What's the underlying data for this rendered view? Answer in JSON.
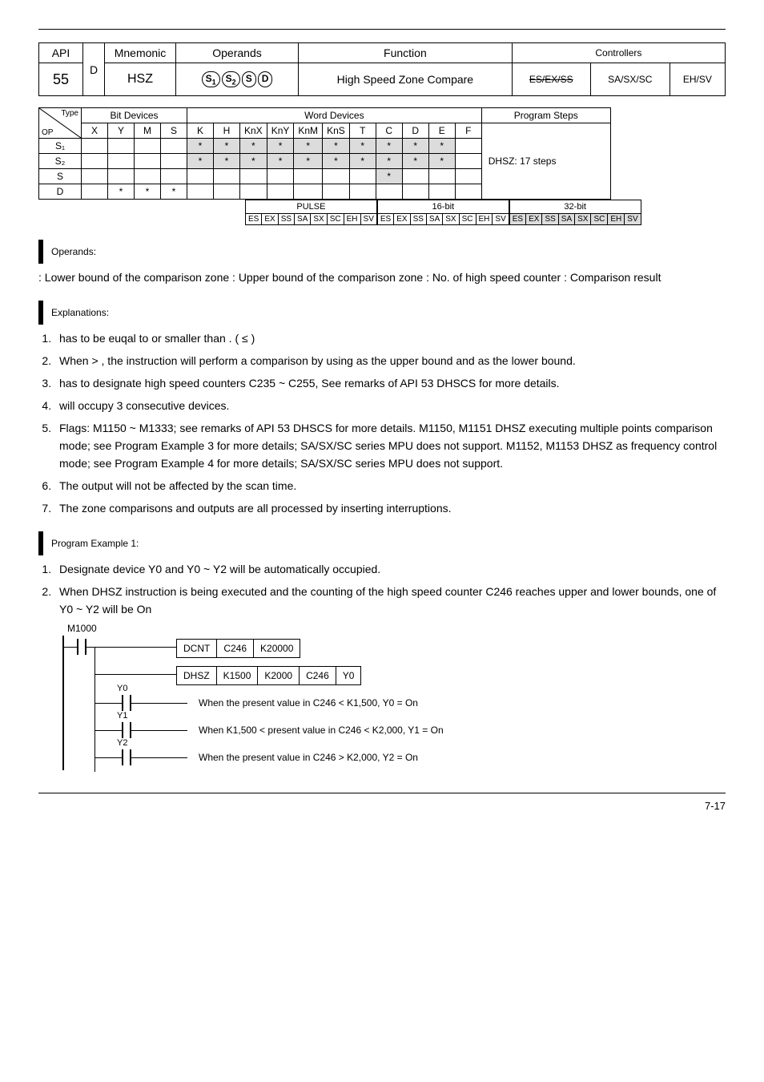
{
  "header": {
    "api_label": "API",
    "api_num": "55",
    "d_label": "D",
    "mnemonic_label": "Mnemonic",
    "mnemonic": "HSZ",
    "operands_label": "Operands",
    "pill_s1": "S",
    "pill_s2": "S",
    "pill_s": "S",
    "pill_d": "D",
    "sub1": "1",
    "sub2": "2",
    "function_label": "Function",
    "function_text": "High Speed Zone Compare",
    "ctrl_label": "Controllers",
    "ctrl_es": "ES/EX/SS",
    "ctrl_sa": "SA/SX/SC",
    "ctrl_eh": "EH/SV"
  },
  "grid": {
    "type_label": "Type",
    "op_label": "OP",
    "bit_label": "Bit Devices",
    "word_label": "Word Devices",
    "steps_label": "Program Steps",
    "cols": [
      "X",
      "Y",
      "M",
      "S",
      "K",
      "H",
      "KnX",
      "KnY",
      "KnM",
      "KnS",
      "T",
      "C",
      "D",
      "E",
      "F"
    ],
    "rows": {
      "s1": "S₁",
      "s2": "S₂",
      "s": "S",
      "d": "D"
    },
    "steps_text": "DHSZ: 17 steps"
  },
  "strip": {
    "pulse": "PULSE",
    "b16": "16-bit",
    "b32": "32-bit",
    "cells": [
      "ES",
      "EX",
      "SS",
      "SA",
      "SX",
      "SC",
      "EH",
      "SV"
    ]
  },
  "opdesc": {
    "title1": "Operands:",
    "line": ": Lower bound of the comparison zone      : Upper bound of the comparison zone      : No. of high speed counter      : Comparison result"
  },
  "expl_title": "Explanations:",
  "expl": [
    "  has to be euqal to or smaller than   . (   ≤   )",
    "When   >   , the instruction will perform a comparison by using   as the upper bound and   as the lower bound.",
    "  has to designate high speed counters C235 ~ C255, See remarks of API 53 DHSCS for more details.",
    "  will occupy 3 consecutive devices.",
    "Flags: M1150 ~ M1333; see remarks of API 53 DHSCS for more details. M1150, M1151 DHSZ executing multiple points comparison mode; see Program Example 3 for more details; SA/SX/SC series MPU does not support. M1152, M1153 DHSZ as frequency control mode; see Program Example 4 for more details; SA/SX/SC series MPU does not support.",
    "The output will not be affected by the scan time.",
    "The zone comparisons and outputs are all processed by inserting interruptions."
  ],
  "pex_title": "Program Example 1:",
  "pex": [
    "Designate device Y0 and Y0 ~ Y2 will be automatically occupied.",
    "When DHSZ instruction is being executed and the counting of the high speed counter C246 reaches upper and lower bounds, one of Y0 ~ Y2 will be On"
  ],
  "ladder": {
    "m1000": "M1000",
    "dcnt_row": [
      "DCNT",
      "C246",
      "K20000"
    ],
    "dhsz_row": [
      "DHSZ",
      "K1500",
      "K2000",
      "C246",
      "Y0"
    ],
    "y0": "Y0",
    "y1": "Y1",
    "y2": "Y2",
    "note_y0": "When the present value in C246 < K1,500, Y0 = On",
    "note_y1": "When K1,500 < present value in C246 < K2,000, Y1 = On",
    "note_y2": "When the present value in C246 > K2,000, Y2 = On"
  },
  "footer": "7-17"
}
